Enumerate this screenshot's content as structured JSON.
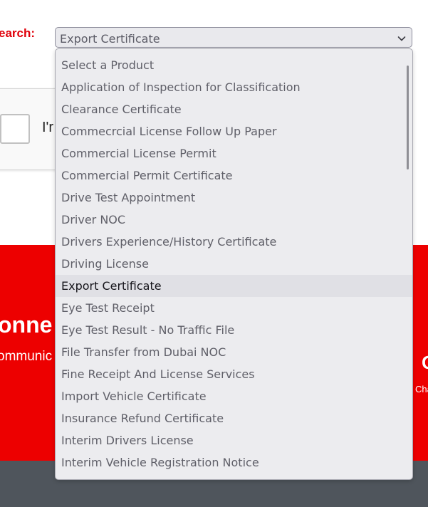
{
  "search": {
    "label": "earch:",
    "selected_value": "Export Certificate"
  },
  "captcha": {
    "label": "I'r"
  },
  "footer_left": {
    "title": "onne",
    "subtitle": "ommunic"
  },
  "footer_right": {
    "title": "C",
    "subtitle": "Cha"
  },
  "dropdown": {
    "options": [
      {
        "label": "Select a Product"
      },
      {
        "label": "Application of Inspection for Classification"
      },
      {
        "label": "Clearance Certificate"
      },
      {
        "label": "Commecrcial License Follow Up Paper"
      },
      {
        "label": "Commercial License Permit"
      },
      {
        "label": "Commercial Permit Certificate"
      },
      {
        "label": "Drive Test Appointment"
      },
      {
        "label": "Driver NOC"
      },
      {
        "label": "Drivers Experience/History Certificate"
      },
      {
        "label": "Driving License"
      },
      {
        "label": "Export Certificate"
      },
      {
        "label": "Eye Test Receipt"
      },
      {
        "label": "Eye Test Result - No Traffic File"
      },
      {
        "label": "File Transfer from Dubai NOC"
      },
      {
        "label": "Fine Receipt And License Services"
      },
      {
        "label": "Import Vehicle Certificate"
      },
      {
        "label": "Insurance Refund Certificate"
      },
      {
        "label": "Interim Drivers License"
      },
      {
        "label": "Interim Vehicle Registration Notice"
      }
    ],
    "selected_index": 10
  },
  "colors": {
    "accent_red": "#ed0000",
    "label_red": "#e0000a",
    "footer_gray": "#4f555c"
  },
  "icons": {
    "select_toggle": "chevron-down-icon"
  }
}
